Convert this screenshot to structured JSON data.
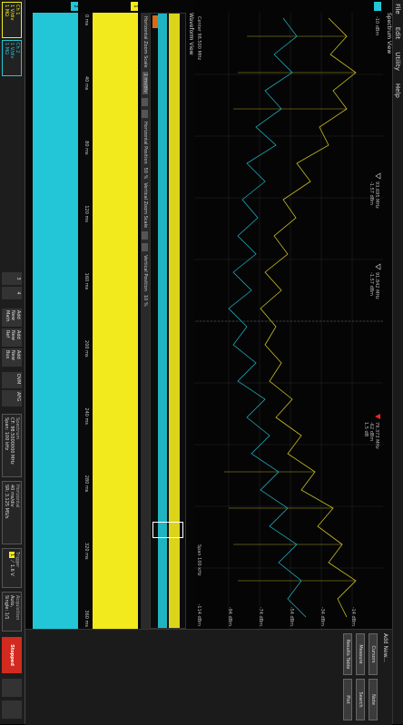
{
  "menu": {
    "file": "File",
    "edit": "Edit",
    "utility": "Utility",
    "help": "Help"
  },
  "spectrum": {
    "title": "Spectrum View",
    "ref_level": "-10 dBm",
    "levels": [
      "-14 dBm",
      "-34 dBm",
      "-54 dBm",
      "-74 dBm",
      "-94 dBm",
      "-114 dBm"
    ],
    "markers": [
      {
        "freq": "93.695 MHz",
        "amp": "-1.57 dBm"
      },
      {
        "freq": "91.842 MHz",
        "amp": "-1.57 dBm"
      },
      {
        "freq": "79.373 MHz",
        "amp": "-62 dBm"
      },
      {
        "freq": "1.5 dB",
        "amp": "-62 dBm"
      }
    ],
    "center_label": "Center 98.500 MHz",
    "span_label": "Span 100 kHz"
  },
  "waveform": {
    "title": "Waveform View",
    "zoom_ticks": [
      "0 s",
      "40 ms",
      "80 ms",
      "120 ms",
      "160 ms",
      "200 ms",
      "240 ms",
      "280 ms",
      "320 ms",
      "360 ms"
    ],
    "time_ticks": [
      "0 ms",
      "40 ms",
      "80 ms",
      "120 ms",
      "160 ms",
      "200 ms",
      "240 ms",
      "280 ms",
      "320 ms",
      "360 ms"
    ],
    "zoom_controls": [
      "Horizontal Zoom Scale",
      "1 ms/div",
      "Horizontal Position",
      "50 %",
      "Vertical Zoom Scale",
      "Vertical Position",
      "10 %"
    ],
    "volt_labels": [
      "4 V",
      "2 V",
      "0 V",
      "-2 V",
      "-4 V"
    ]
  },
  "bottom": {
    "ch1": {
      "name": "Ch 1",
      "scale": "1 V/div",
      "imp": "1 MΩ",
      "bw": "1 GHz"
    },
    "ch2": {
      "name": "Ch 2",
      "scale": "1 V/div",
      "imp": "1 MΩ",
      "bw": "1 GHz"
    },
    "ch3": "3",
    "ch4": "4",
    "add_math": "Add New Math",
    "add_ref": "Add New Ref",
    "add_bus": "Add New Bus",
    "dvm": "DVM",
    "afg": "AFG",
    "spectrum": {
      "title": "Spectrum",
      "cf": "CF: 98.5000000 MHz",
      "span": "Span: 100 kHz",
      "rbw": "RBW: 2.00 kHz"
    },
    "horizontal": {
      "title": "Horizontal",
      "scale": "40 ms/div",
      "sr": "SR: 3.125 MS/s",
      "rl": "RL: 1.25 Mpts",
      "time": "400 ms",
      "pts": "320 ns/pt",
      "pos": "◆ 8.8%"
    },
    "trigger": {
      "title": "Trigger",
      "ch": "1",
      "slope": "⟋",
      "level": "1.6 V"
    },
    "acquisition": {
      "title": "Acquisition",
      "mode": "Auto,",
      "analyze": "Analyze",
      "bits": "12 bits",
      "sample": "Sample: 12 bits",
      "single": "Single: 1/1"
    }
  },
  "right": {
    "add_new": "Add New...",
    "cursors": "Cursors",
    "note": "Note",
    "measure": "Measure",
    "search": "Search",
    "results_table": "Results Table",
    "plot": "Plot",
    "stopped": "Stopped"
  },
  "colors": {
    "ch1": "#f2ea1c",
    "ch2": "#22c6d6",
    "stopped": "#d32a1f",
    "marker_red": "#ff2222"
  }
}
